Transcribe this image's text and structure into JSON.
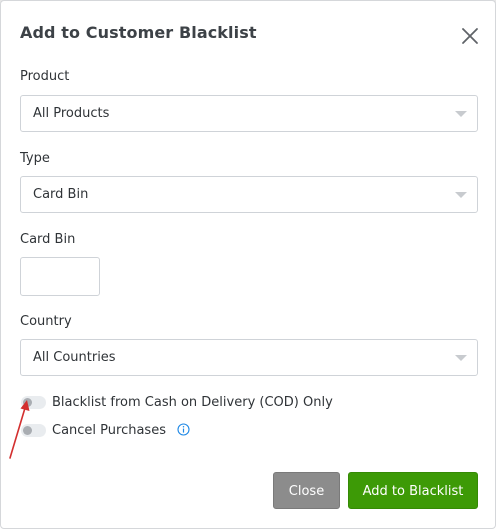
{
  "modal": {
    "title": "Add to Customer Blacklist"
  },
  "fields": {
    "product": {
      "label": "Product",
      "value": "All Products"
    },
    "type": {
      "label": "Type",
      "value": "Card Bin"
    },
    "card_bin": {
      "label": "Card Bin",
      "value": ""
    },
    "country": {
      "label": "Country",
      "value": "All Countries"
    }
  },
  "toggles": {
    "cod_only": {
      "label": "Blacklist from Cash on Delivery (COD) Only",
      "on": false
    },
    "cancel_purchases": {
      "label": "Cancel Purchases",
      "on": false
    }
  },
  "buttons": {
    "close": "Close",
    "add": "Add to Blacklist"
  },
  "colors": {
    "primary_button": "#3d9a06",
    "secondary_button": "#8c8c8c",
    "annotation_arrow": "#d32f2f",
    "info_icon": "#1e88e5"
  },
  "icons": {
    "close": "close-icon",
    "dropdown": "chevron-down-icon",
    "info": "info-icon",
    "annotation": "arrow-annotation"
  }
}
